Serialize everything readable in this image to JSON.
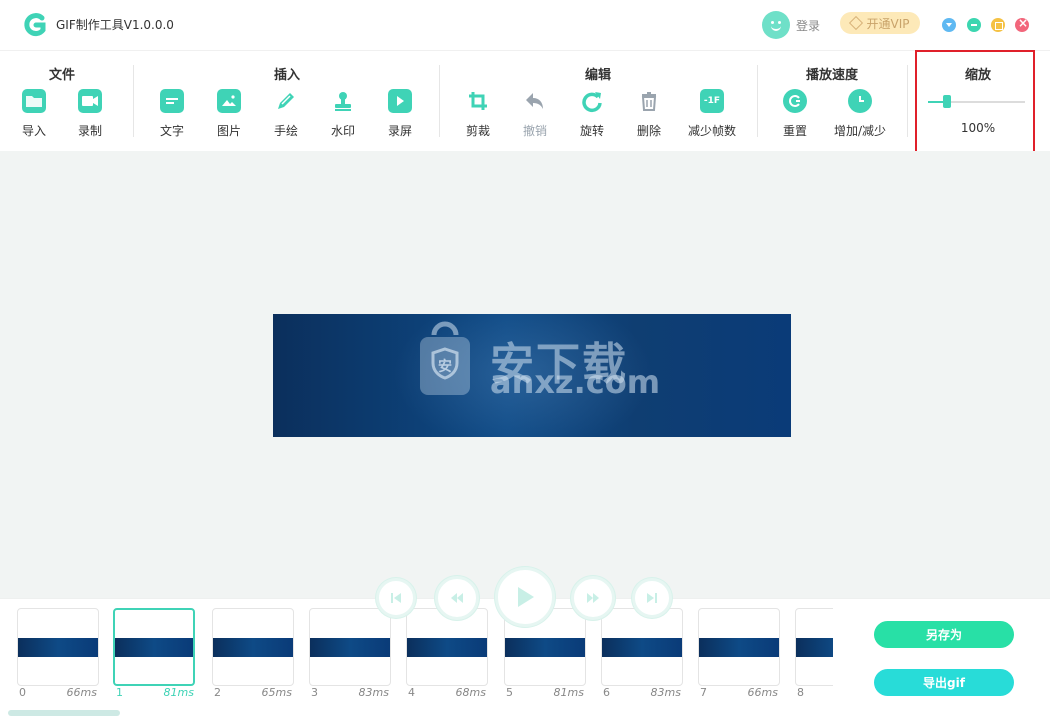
{
  "window": {
    "title": "GIF制作工具V1.0.0.0",
    "login_label": "登录",
    "vip_label": "开通VIP"
  },
  "toolbar": {
    "groups": [
      {
        "title": "文件",
        "tools": [
          "导入",
          "录制"
        ]
      },
      {
        "title": "插入",
        "tools": [
          "文字",
          "图片",
          "手绘",
          "水印",
          "录屏"
        ]
      },
      {
        "title": "编辑",
        "tools": [
          "剪裁",
          "撤销",
          "旋转",
          "删除",
          "减少帧数"
        ]
      },
      {
        "title": "播放速度",
        "tools": [
          "重置",
          "增加/减少"
        ]
      },
      {
        "title": "缩放",
        "tools": []
      }
    ],
    "reduce_frames_icon_text": "-1F"
  },
  "zoom": {
    "value_label": "100%",
    "slider_fraction": 0.2
  },
  "preview": {
    "watermark_cn": "安下载",
    "watermark_en": "anxz.com",
    "watermark_icon_char": "安"
  },
  "frames": [
    {
      "index": "0",
      "duration": "66ms"
    },
    {
      "index": "1",
      "duration": "81ms"
    },
    {
      "index": "2",
      "duration": "65ms"
    },
    {
      "index": "3",
      "duration": "83ms"
    },
    {
      "index": "4",
      "duration": "68ms"
    },
    {
      "index": "5",
      "duration": "81ms"
    },
    {
      "index": "6",
      "duration": "83ms"
    },
    {
      "index": "7",
      "duration": "66ms"
    },
    {
      "index": "8",
      "duration": ""
    }
  ],
  "selected_frame": 1,
  "actions": {
    "save_as": "另存为",
    "export_gif": "导出gif"
  },
  "colors": {
    "accent": "#3fd3b6",
    "highlight_box": "#e0202a",
    "canvas_bg": "#f1f4f3"
  }
}
